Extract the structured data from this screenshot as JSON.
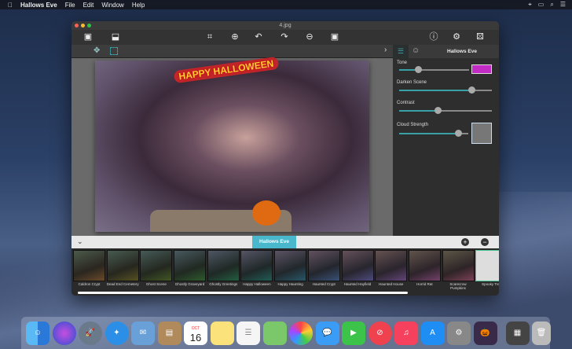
{
  "menubar": {
    "app": "Hallows Eve",
    "items": [
      "File",
      "Edit",
      "Window",
      "Help"
    ]
  },
  "window": {
    "title": "4.jpg"
  },
  "photo": {
    "overlay_text": "HAPPY HALLOWEEN"
  },
  "panel": {
    "tab_title": "Hallows Eve",
    "sliders": [
      {
        "label": "Tone",
        "value": 0.27
      },
      {
        "label": "Darken Scene",
        "value": 0.78
      },
      {
        "label": "Contrast",
        "value": 0.42
      },
      {
        "label": "Cloud Strength",
        "value": 0.86
      }
    ],
    "tone_color": "#c22cc4"
  },
  "strip": {
    "category": "Hallows Eve",
    "thumbnails": [
      "Caldron Crypt",
      "Dead End Cemetery",
      "Ghost Scene",
      "Ghostly Graveyard",
      "Ghostly Greetings",
      "Happy Halloween",
      "Happy Haunting",
      "Haunted Crypt",
      "Haunted Hayfield",
      "Haunted House",
      "Horrid Rat",
      "Scarecrow Pumpkins",
      "Spooky Tree"
    ],
    "selected": "Spooky Tree"
  },
  "dock": {
    "calendar_month": "OCT",
    "calendar_day": "16",
    "apps": [
      "finder",
      "siri",
      "launchpad",
      "safari",
      "mail",
      "contacts",
      "calendar",
      "notes",
      "reminders",
      "maps",
      "photos",
      "messages",
      "facetime",
      "news",
      "music",
      "app-store",
      "system-preferences",
      "hallows-eve",
      "downloads",
      "trash"
    ]
  }
}
